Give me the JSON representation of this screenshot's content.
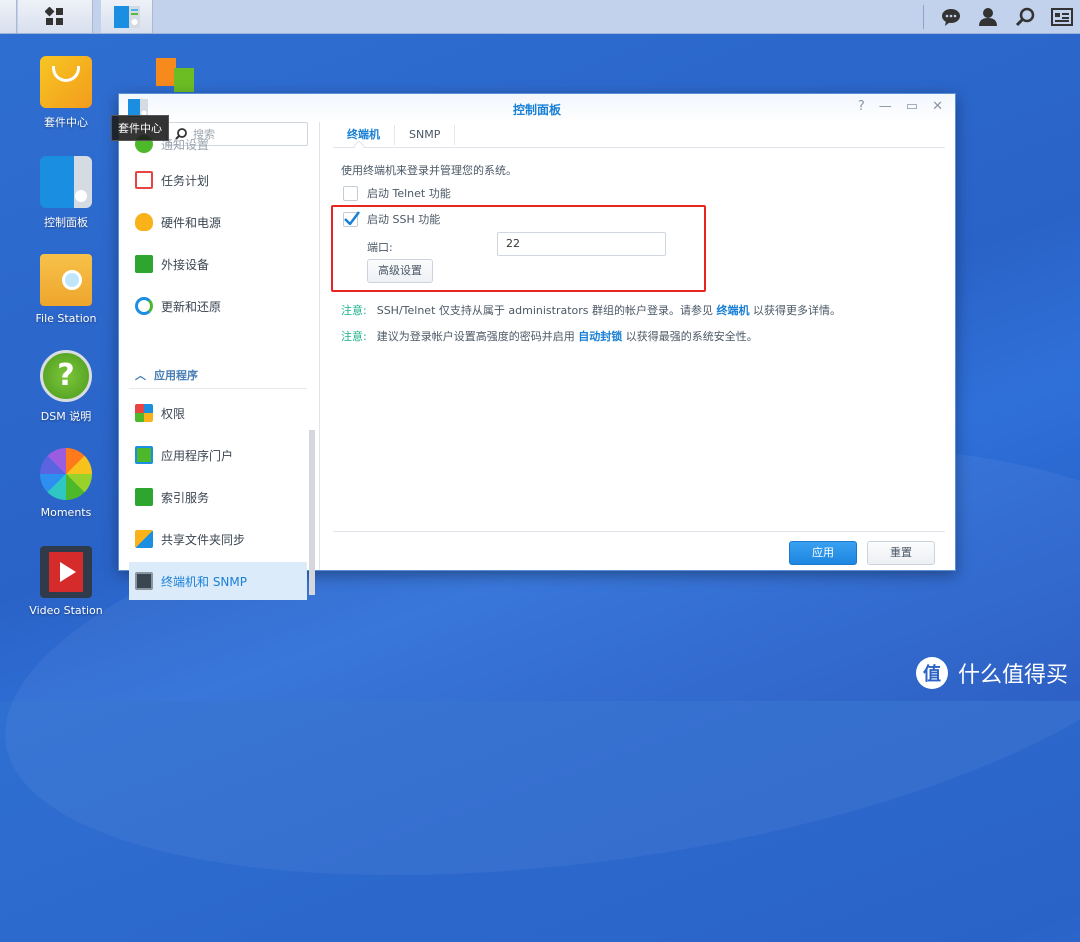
{
  "taskbar": {
    "main_menu_icon": "main-menu-icon",
    "open_app_icon": "control-panel-icon",
    "right_icons": [
      "chat-icon",
      "user-icon",
      "search-icon",
      "widgets-icon"
    ]
  },
  "desktop": {
    "icons": [
      {
        "label": "套件中心",
        "icon": "package-center-icon"
      },
      {
        "label": "控制面板",
        "icon": "control-panel-icon"
      },
      {
        "label": "File Station",
        "icon": "file-station-icon"
      },
      {
        "label": "DSM 说明",
        "icon": "dsm-help-icon"
      },
      {
        "label": "Moments",
        "icon": "moments-icon"
      },
      {
        "label": "Video Station",
        "icon": "video-station-icon"
      }
    ],
    "download_station_icon": "download-station-icon"
  },
  "tooltip": "套件中心",
  "window": {
    "title": "控制面板",
    "controls": {
      "help": "?",
      "minimize": "—",
      "maximize": "▭",
      "close": "✕"
    },
    "search_placeholder": "搜索",
    "sidebar": {
      "partial_item": "通知设置",
      "items": [
        {
          "label": "任务计划",
          "icon": "task-scheduler-icon"
        },
        {
          "label": "硬件和电源",
          "icon": "bulb-icon"
        },
        {
          "label": "外接设备",
          "icon": "external-device-icon"
        },
        {
          "label": "更新和还原",
          "icon": "update-restore-icon"
        }
      ],
      "section": "应用程序",
      "app_items": [
        {
          "label": "权限",
          "icon": "privileges-icon"
        },
        {
          "label": "应用程序门户",
          "icon": "app-portal-icon"
        },
        {
          "label": "索引服务",
          "icon": "indexing-icon"
        },
        {
          "label": "共享文件夹同步",
          "icon": "folder-sync-icon"
        },
        {
          "label": "终端机和 SNMP",
          "icon": "terminal-icon",
          "active": true
        }
      ]
    },
    "tabs": [
      {
        "label": "终端机",
        "active": true
      },
      {
        "label": "SNMP",
        "active": false
      }
    ],
    "description": "使用终端机来登录并管理您的系统。",
    "telnet": {
      "label": "启动 Telnet 功能",
      "checked": false
    },
    "ssh": {
      "label": "启动 SSH 功能",
      "checked": true
    },
    "port": {
      "label": "端口:",
      "value": "22"
    },
    "advanced_button": "高级设置",
    "notes": [
      {
        "prefix": "注意:",
        "before": "SSH/Telnet 仅支持从属于 administrators 群组的帐户登录。请参见",
        "link": "终端机",
        "after": "以获得更多详情。"
      },
      {
        "prefix": "注意:",
        "before": "建议为登录帐户设置高强度的密码并启用",
        "link": "自动封锁",
        "after": "以获得最强的系统安全性。"
      }
    ],
    "apply_button": "应用",
    "reset_button": "重置"
  },
  "watermark": {
    "badge": "值",
    "text": "什么值得买"
  },
  "colors": {
    "accent": "#1a80d6",
    "highlight_box": "#e8261f",
    "note": "#1fb28c"
  }
}
